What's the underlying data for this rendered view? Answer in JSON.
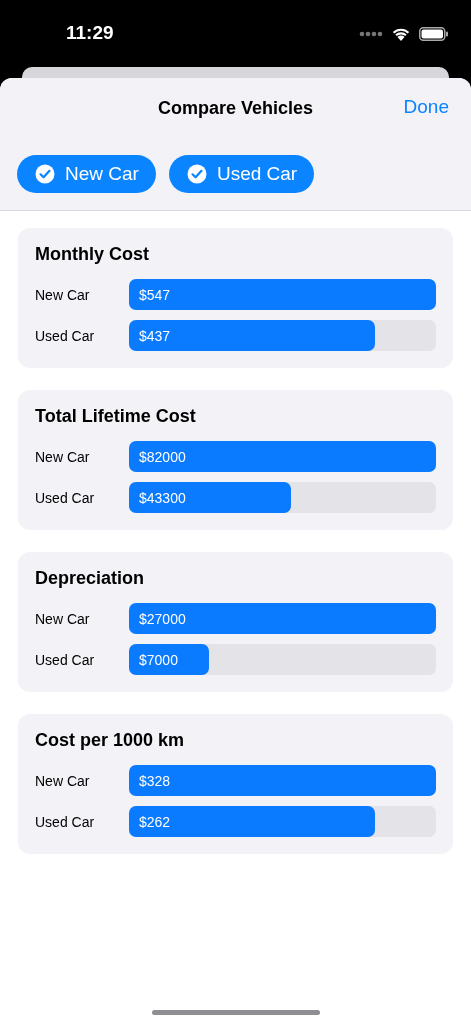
{
  "status_bar": {
    "time": "11:29"
  },
  "header": {
    "title": "Compare Vehicles",
    "done": "Done"
  },
  "filters": [
    {
      "label": "New Car",
      "selected": true
    },
    {
      "label": "Used Car",
      "selected": true
    }
  ],
  "cards": [
    {
      "title": "Monthly Cost",
      "rows": [
        {
          "label": "New Car",
          "value": "$547",
          "level": 1.0
        },
        {
          "label": "Used Car",
          "value": "$437",
          "level": 0.8
        }
      ]
    },
    {
      "title": "Total Lifetime Cost",
      "rows": [
        {
          "label": "New Car",
          "value": "$82000",
          "level": 1.0
        },
        {
          "label": "Used Car",
          "value": "$43300",
          "level": 0.528
        }
      ]
    },
    {
      "title": "Depreciation",
      "rows": [
        {
          "label": "New Car",
          "value": "$27000",
          "level": 1.0
        },
        {
          "label": "Used Car",
          "value": "$7000",
          "level": 0.259
        }
      ]
    },
    {
      "title": "Cost per 1000 km",
      "rows": [
        {
          "label": "New Car",
          "value": "$328",
          "level": 1.0
        },
        {
          "label": "Used Car",
          "value": "$262",
          "level": 0.8
        }
      ]
    }
  ]
}
